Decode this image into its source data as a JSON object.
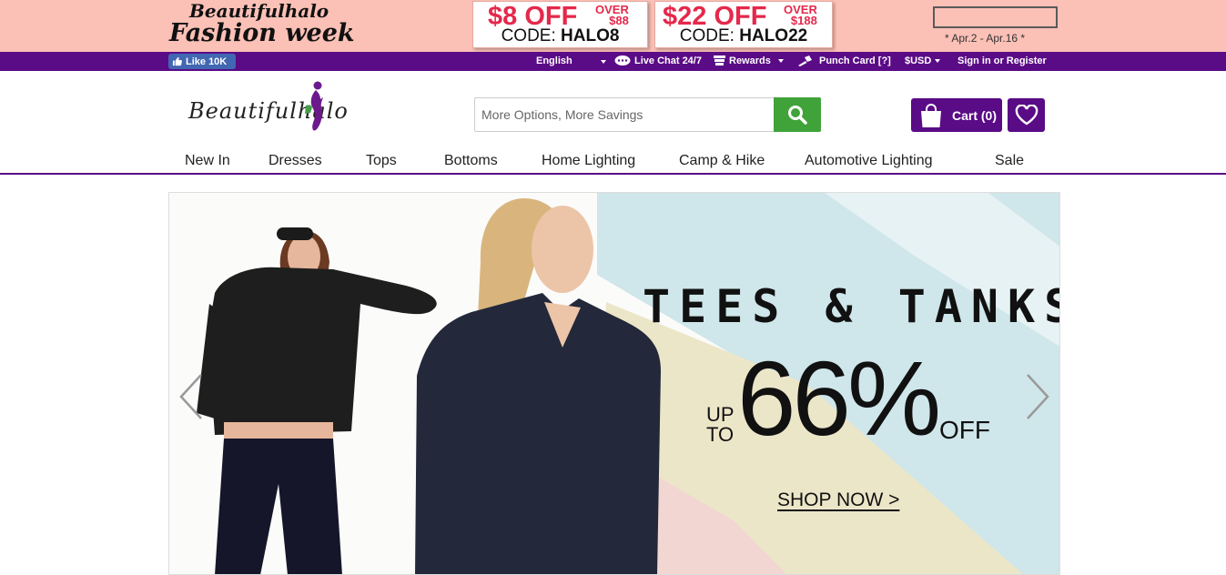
{
  "promo": {
    "fw_line1": "Beautifulhalo",
    "fw_line2": "Fashion week",
    "coupons": [
      {
        "amount": "$8 OFF",
        "over": "OVER",
        "threshold": "$88",
        "code_label": "CODE:",
        "code": "HALO8"
      },
      {
        "amount": "$22 OFF",
        "over": "OVER",
        "threshold": "$188",
        "code_label": "CODE:",
        "code": "HALO22"
      }
    ],
    "dates": "* Apr.2 - Apr.16 *"
  },
  "util": {
    "like": "Like 10K",
    "language": "English",
    "live_chat": "Live Chat 24/7",
    "rewards": "Rewards",
    "punch_card": "Punch Card [?]",
    "currency": "$USD",
    "sign_in": "Sign in or Register"
  },
  "header": {
    "logo_text": "Beautifulhalo",
    "search_placeholder": "More Options, More Savings",
    "cart_label": "Cart (0)"
  },
  "nav": {
    "items": [
      "New In",
      "Dresses",
      "Tops",
      "Bottoms",
      "Home Lighting",
      "Camp & Hike",
      "Automotive Lighting",
      "Sale"
    ]
  },
  "banner": {
    "headline": "TEES & TANKS",
    "up": "UP",
    "to": "TO",
    "percent": "66%",
    "off": "OFF",
    "cta": "SHOP NOW >"
  },
  "colors": {
    "promo_bg": "#fbc0b6",
    "brand_purple": "#5a0b86",
    "search_green": "#3fa33a",
    "coupon_red": "#e5284b",
    "facebook_blue": "#4267b2"
  }
}
